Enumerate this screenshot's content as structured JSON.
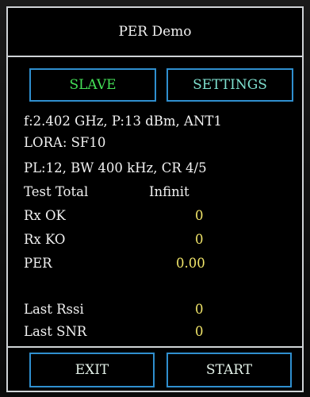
{
  "header": {
    "title": "PER Demo"
  },
  "top_buttons": {
    "slave": "SLAVE",
    "settings": "SETTINGS"
  },
  "info": {
    "line1": "f:2.402 GHz, P:13 dBm, ANT1",
    "line2": "LORA: SF10",
    "line3": "PL:12, BW 400 kHz, CR 4/5"
  },
  "stats": {
    "test_total_label": "Test Total",
    "test_total_value": "Infinit",
    "rx_ok_label": "Rx OK",
    "rx_ok_value": "0",
    "rx_ko_label": "Rx KO",
    "rx_ko_value": "0",
    "per_label": "PER",
    "per_value": "0.00",
    "last_rssi_label": "Last Rssi",
    "last_rssi_value": "0",
    "last_snr_label": "Last SNR",
    "last_snr_value": "0"
  },
  "bottom_buttons": {
    "exit": "EXIT",
    "start": "START"
  },
  "colors": {
    "background": "#000000",
    "frame": "#cfd3d6",
    "button_border": "#2f8fcf",
    "slave_text": "#44e157",
    "settings_text": "#7fe0cf",
    "value_text": "#f2e66a",
    "label_text": "#f2f2f2"
  }
}
